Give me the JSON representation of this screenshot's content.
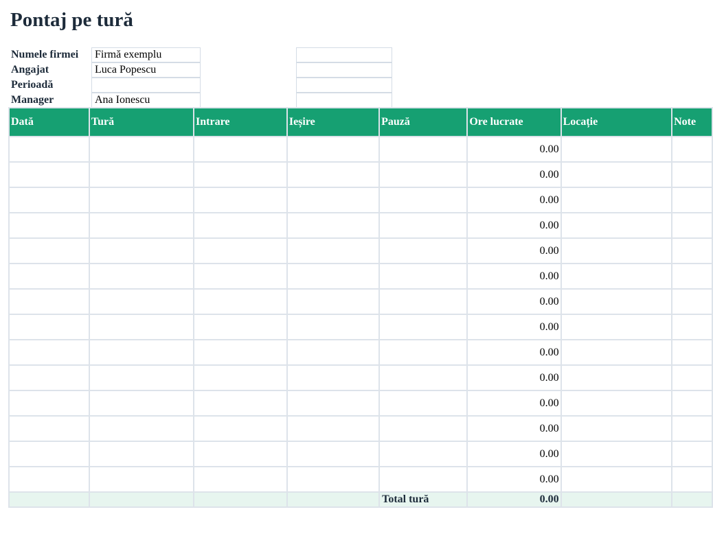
{
  "title": "Pontaj pe tură",
  "info": {
    "company_label": "Numele firmei",
    "company_value": "Firmă exemplu",
    "employee_label": "Angajat",
    "employee_value": "Luca Popescu",
    "period_label": "Perioadă",
    "period_value": "",
    "manager_label": "Manager",
    "manager_value": "Ana Ionescu"
  },
  "table": {
    "headers": [
      "Dată",
      "Tură",
      "Intrare",
      "Ieșire",
      "Pauză",
      "Ore lucrate",
      "Locație",
      "Note"
    ],
    "rows": [
      {
        "hours": "0.00"
      },
      {
        "hours": "0.00"
      },
      {
        "hours": "0.00"
      },
      {
        "hours": "0.00"
      },
      {
        "hours": "0.00"
      },
      {
        "hours": "0.00"
      },
      {
        "hours": "0.00"
      },
      {
        "hours": "0.00"
      },
      {
        "hours": "0.00"
      },
      {
        "hours": "0.00"
      },
      {
        "hours": "0.00"
      },
      {
        "hours": "0.00"
      },
      {
        "hours": "0.00"
      },
      {
        "hours": "0.00"
      }
    ],
    "total_label": "Total tură",
    "total_value": "0.00"
  },
  "colors": {
    "header_bg": "#16a072",
    "total_bg": "#e7f5ef",
    "title": "#1d2b3a"
  }
}
